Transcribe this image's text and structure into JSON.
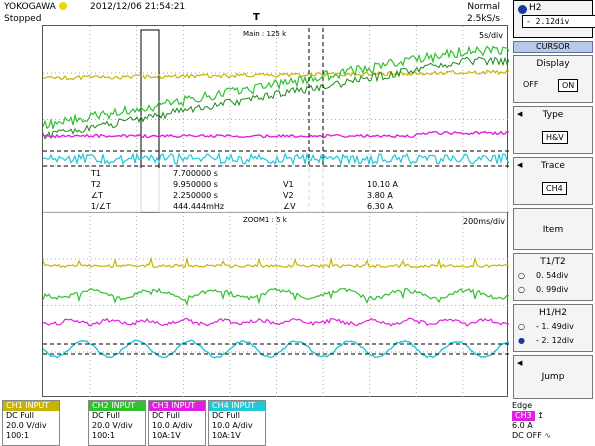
{
  "header": {
    "brand": "YOKOGAWA",
    "datetime": "2012/12/06 21:54:21",
    "run_state": "Stopped",
    "acq_mode": "Normal",
    "sample_rate": "2.5kS/s"
  },
  "main_window": {
    "label": "Main : 125 k",
    "timebase": "5s/div"
  },
  "zoom_window": {
    "label": "ZOOM1 : 5 k",
    "timebase": "200ms/div"
  },
  "measurements": {
    "t1_label": "T1",
    "t1_value": "7.700000 s",
    "t2_label": "T2",
    "t2_value": "9.950000 s",
    "dt_label": "∠T",
    "dt_value": "2.250000 s",
    "inv_label": "1/∠T",
    "inv_value": "444.444mHz",
    "v1_label": "V1",
    "v1_value": "10.10 A",
    "v2_label": "V2",
    "v2_value": "3.80 A",
    "dv_label": "∠V",
    "dv_value": "6.30 A"
  },
  "panel": {
    "h2_label": "H2",
    "h2_value": "- 2.12div",
    "cursor_title": "CURSOR",
    "display_label": "Display",
    "display_off": "OFF",
    "display_on": "ON",
    "type_label": "Type",
    "type_value": "H&V",
    "trace_label": "Trace",
    "trace_value": "CH4",
    "item_label": "Item",
    "t1t2_label": "T1/T2",
    "t1_pos": "0. 54div",
    "t2_pos": "0. 99div",
    "h1h2_label": "H1/H2",
    "h1_pos": "- 1. 49div",
    "h2_pos": "- 2. 12div",
    "jump_label": "Jump"
  },
  "channels": [
    {
      "head": "CH1 INPUT",
      "coupling": "DC Full",
      "scale": "20.0 V/div",
      "probe": "100:1",
      "color": "#c8b400"
    },
    {
      "head": "CH2 INPUT",
      "coupling": "DC Full",
      "scale": "20.0 V/div",
      "probe": "100:1",
      "color": "#30c030"
    },
    {
      "head": "CH3 INPUT",
      "coupling": "DC Full",
      "scale": "10.0 A/div",
      "probe": "10A:1V",
      "color": "#e020e0"
    },
    {
      "head": "CH4 INPUT",
      "coupling": "DC Full",
      "scale": "10.0 A/div",
      "probe": "10A:1V",
      "color": "#20c8d8"
    }
  ],
  "trigger": {
    "mode": "Edge",
    "channel": "CH3",
    "level": "6.0 A",
    "coupling": "DC OFF"
  },
  "colors": {
    "ch1": "#c8b400",
    "ch2": "#30c030",
    "ch3": "#e020e0",
    "ch4": "#20c8d8",
    "panel_accent": "#1a3a9a"
  }
}
